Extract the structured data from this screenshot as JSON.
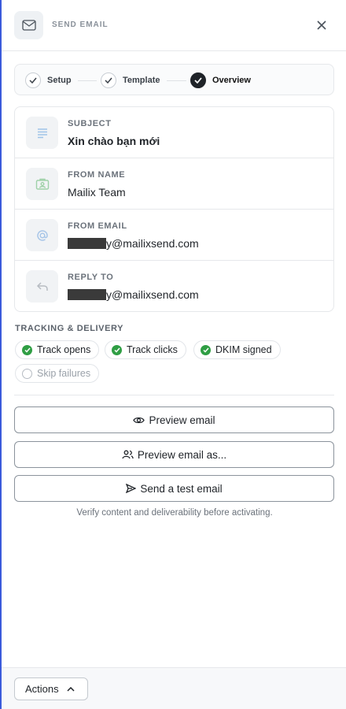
{
  "header": {
    "title": "SEND EMAIL",
    "icon": "mail-icon",
    "close_icon": "close-icon"
  },
  "stepper": {
    "steps": [
      {
        "label": "Setup",
        "state": "done"
      },
      {
        "label": "Template",
        "state": "done"
      },
      {
        "label": "Overview",
        "state": "active"
      }
    ]
  },
  "details": [
    {
      "label": "SUBJECT",
      "value": "Xin chào bạn mới",
      "icon": "text-lines-icon"
    },
    {
      "label": "FROM NAME",
      "value": "Mailix Team",
      "icon": "id-card-icon"
    },
    {
      "label": "FROM EMAIL",
      "value_hidden": "[redacted]",
      "value_suffix": "y@mailixsend.com",
      "icon": "at-sign-icon"
    },
    {
      "label": "REPLY TO",
      "value_hidden": "[redacted]",
      "value_suffix": "y@mailixsend.com",
      "icon": "reply-icon"
    }
  ],
  "tracking": {
    "title": "TRACKING & DELIVERY",
    "chips": [
      {
        "label": "Track opens",
        "enabled": true
      },
      {
        "label": "Track clicks",
        "enabled": true
      },
      {
        "label": "DKIM signed",
        "enabled": true
      },
      {
        "label": "Skip failures",
        "enabled": false
      }
    ]
  },
  "buttons": {
    "preview": "Preview email",
    "preview_as": "Preview email as...",
    "test": "Send a test email"
  },
  "hint": "Verify content and deliverability before activating.",
  "footer": {
    "actions_label": "Actions"
  },
  "colors": {
    "accent_border": "#3b5bdb",
    "success": "#2f9e44",
    "dark": "#1f2328"
  }
}
